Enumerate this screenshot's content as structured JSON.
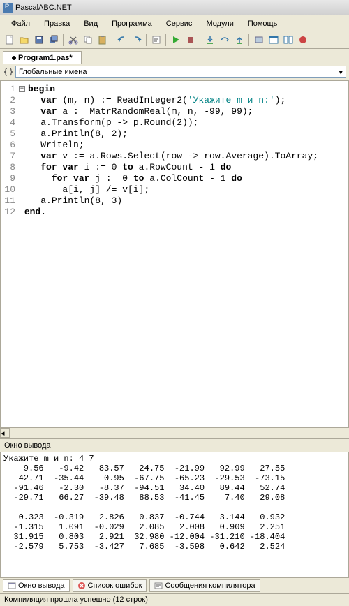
{
  "title": "PascalABC.NET",
  "menu": [
    "Файл",
    "Правка",
    "Вид",
    "Программа",
    "Сервис",
    "Модули",
    "Помощь"
  ],
  "tab": "Program1.pas*",
  "scope": "Глобальные имена",
  "lines": [
    "1",
    "2",
    "3",
    "4",
    "5",
    "6",
    "7",
    "8",
    "9",
    "10",
    "11",
    "12"
  ],
  "code": {
    "l1a": "begin",
    "l2a": "   var",
    "l2b": " (m, n) := ReadInteger2(",
    "l2c": "'Укажите m и n:'",
    "l2d": ");",
    "l3a": "   var",
    "l3b": " a := MatrRandomReal(m, n, -99, 99);",
    "l4": "   a.Transform(p -> p.Round(2));",
    "l5": "   a.Println(8, 2);",
    "l6": "   Writeln;",
    "l7a": "   var",
    "l7b": " v := a.Rows.Select(row -> row.Average).ToArray;",
    "l8a": "   for var",
    "l8b": " i := 0 ",
    "l8c": "to",
    "l8d": " a.RowCount - 1 ",
    "l8e": "do",
    "l9a": "     for var",
    "l9b": " j := 0 ",
    "l9c": "to",
    "l9d": " a.ColCount - 1 ",
    "l9e": "do",
    "l10": "       a[i, j] /= v[i];",
    "l11": "   a.Println(8, 3)",
    "l12": "end."
  },
  "out_label": "Окно вывода",
  "output": "Укажите m и n: 4 7\n    9.56   -9.42   83.57   24.75  -21.99   92.99   27.55\n   42.71  -35.44    0.95  -67.75  -65.23  -29.53  -73.15\n  -91.46   -2.30   -8.37  -94.51   34.40   89.44   52.74\n  -29.71   66.27  -39.48   88.53  -41.45    7.40   29.08\n\n   0.323  -0.319   2.826   0.837  -0.744   3.144   0.932\n  -1.315   1.091  -0.029   2.085   2.008   0.909   2.251\n  31.915   0.803   2.921  32.980 -12.004 -31.210 -18.404\n  -2.579   5.753  -3.427   7.685  -3.598   0.642   2.524",
  "btabs": {
    "t1": "Окно вывода",
    "t2": "Список ошибок",
    "t3": "Сообщения компилятора"
  },
  "status": "Компиляция прошла успешно (12 строк)"
}
